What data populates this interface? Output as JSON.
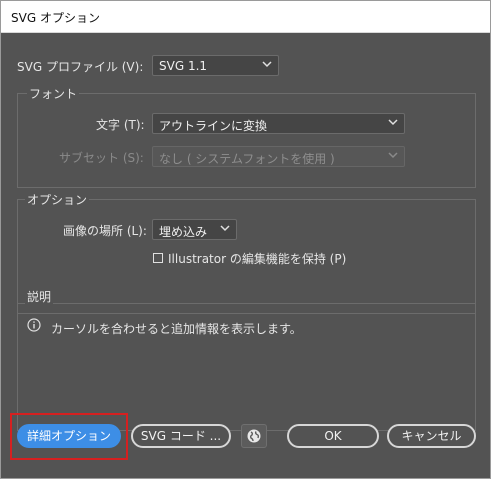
{
  "window": {
    "title": "SVG オプション"
  },
  "profile": {
    "label": "SVG プロファイル (V):",
    "value": "SVG 1.1"
  },
  "font_section": {
    "title": "フォント",
    "type_label": "文字 (T):",
    "type_value": "アウトラインに変換",
    "subset_label": "サブセット (S):",
    "subset_value": "なし ( システムフォントを使用 )"
  },
  "options_section": {
    "title": "オプション",
    "image_location_label": "画像の場所 (L):",
    "image_location_value": "埋め込み",
    "preserve_checkbox_label": "Illustrator の編集機能を保持 (P)",
    "preserve_checked": false
  },
  "description_section": {
    "title": "説明",
    "text": "カーソルを合わせると追加情報を表示します。"
  },
  "buttons": {
    "advanced": "詳細オプション",
    "svg_code": "SVG コード ...",
    "ok": "OK",
    "cancel": "キャンセル"
  },
  "colors": {
    "dialog_bg": "#535353",
    "primary_button": "#3d8ee6",
    "highlight_border": "#d62020"
  },
  "icons": [
    "chevron-down-icon",
    "info-icon",
    "globe-icon"
  ]
}
